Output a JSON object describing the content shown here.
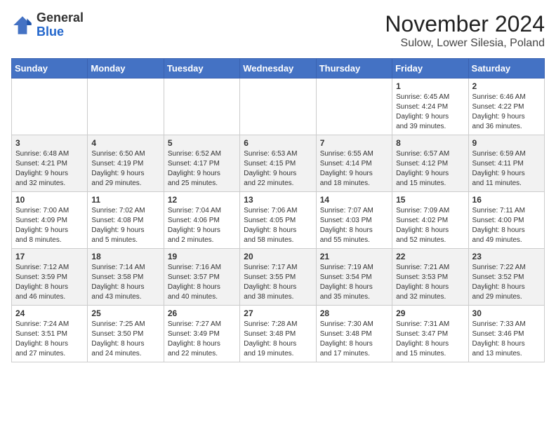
{
  "header": {
    "logo_general": "General",
    "logo_blue": "Blue",
    "month": "November 2024",
    "location": "Sulow, Lower Silesia, Poland"
  },
  "days_of_week": [
    "Sunday",
    "Monday",
    "Tuesday",
    "Wednesday",
    "Thursday",
    "Friday",
    "Saturday"
  ],
  "weeks": [
    [
      {
        "day": "",
        "info": ""
      },
      {
        "day": "",
        "info": ""
      },
      {
        "day": "",
        "info": ""
      },
      {
        "day": "",
        "info": ""
      },
      {
        "day": "",
        "info": ""
      },
      {
        "day": "1",
        "info": "Sunrise: 6:45 AM\nSunset: 4:24 PM\nDaylight: 9 hours\nand 39 minutes."
      },
      {
        "day": "2",
        "info": "Sunrise: 6:46 AM\nSunset: 4:22 PM\nDaylight: 9 hours\nand 36 minutes."
      }
    ],
    [
      {
        "day": "3",
        "info": "Sunrise: 6:48 AM\nSunset: 4:21 PM\nDaylight: 9 hours\nand 32 minutes."
      },
      {
        "day": "4",
        "info": "Sunrise: 6:50 AM\nSunset: 4:19 PM\nDaylight: 9 hours\nand 29 minutes."
      },
      {
        "day": "5",
        "info": "Sunrise: 6:52 AM\nSunset: 4:17 PM\nDaylight: 9 hours\nand 25 minutes."
      },
      {
        "day": "6",
        "info": "Sunrise: 6:53 AM\nSunset: 4:15 PM\nDaylight: 9 hours\nand 22 minutes."
      },
      {
        "day": "7",
        "info": "Sunrise: 6:55 AM\nSunset: 4:14 PM\nDaylight: 9 hours\nand 18 minutes."
      },
      {
        "day": "8",
        "info": "Sunrise: 6:57 AM\nSunset: 4:12 PM\nDaylight: 9 hours\nand 15 minutes."
      },
      {
        "day": "9",
        "info": "Sunrise: 6:59 AM\nSunset: 4:11 PM\nDaylight: 9 hours\nand 11 minutes."
      }
    ],
    [
      {
        "day": "10",
        "info": "Sunrise: 7:00 AM\nSunset: 4:09 PM\nDaylight: 9 hours\nand 8 minutes."
      },
      {
        "day": "11",
        "info": "Sunrise: 7:02 AM\nSunset: 4:08 PM\nDaylight: 9 hours\nand 5 minutes."
      },
      {
        "day": "12",
        "info": "Sunrise: 7:04 AM\nSunset: 4:06 PM\nDaylight: 9 hours\nand 2 minutes."
      },
      {
        "day": "13",
        "info": "Sunrise: 7:06 AM\nSunset: 4:05 PM\nDaylight: 8 hours\nand 58 minutes."
      },
      {
        "day": "14",
        "info": "Sunrise: 7:07 AM\nSunset: 4:03 PM\nDaylight: 8 hours\nand 55 minutes."
      },
      {
        "day": "15",
        "info": "Sunrise: 7:09 AM\nSunset: 4:02 PM\nDaylight: 8 hours\nand 52 minutes."
      },
      {
        "day": "16",
        "info": "Sunrise: 7:11 AM\nSunset: 4:00 PM\nDaylight: 8 hours\nand 49 minutes."
      }
    ],
    [
      {
        "day": "17",
        "info": "Sunrise: 7:12 AM\nSunset: 3:59 PM\nDaylight: 8 hours\nand 46 minutes."
      },
      {
        "day": "18",
        "info": "Sunrise: 7:14 AM\nSunset: 3:58 PM\nDaylight: 8 hours\nand 43 minutes."
      },
      {
        "day": "19",
        "info": "Sunrise: 7:16 AM\nSunset: 3:57 PM\nDaylight: 8 hours\nand 40 minutes."
      },
      {
        "day": "20",
        "info": "Sunrise: 7:17 AM\nSunset: 3:55 PM\nDaylight: 8 hours\nand 38 minutes."
      },
      {
        "day": "21",
        "info": "Sunrise: 7:19 AM\nSunset: 3:54 PM\nDaylight: 8 hours\nand 35 minutes."
      },
      {
        "day": "22",
        "info": "Sunrise: 7:21 AM\nSunset: 3:53 PM\nDaylight: 8 hours\nand 32 minutes."
      },
      {
        "day": "23",
        "info": "Sunrise: 7:22 AM\nSunset: 3:52 PM\nDaylight: 8 hours\nand 29 minutes."
      }
    ],
    [
      {
        "day": "24",
        "info": "Sunrise: 7:24 AM\nSunset: 3:51 PM\nDaylight: 8 hours\nand 27 minutes."
      },
      {
        "day": "25",
        "info": "Sunrise: 7:25 AM\nSunset: 3:50 PM\nDaylight: 8 hours\nand 24 minutes."
      },
      {
        "day": "26",
        "info": "Sunrise: 7:27 AM\nSunset: 3:49 PM\nDaylight: 8 hours\nand 22 minutes."
      },
      {
        "day": "27",
        "info": "Sunrise: 7:28 AM\nSunset: 3:48 PM\nDaylight: 8 hours\nand 19 minutes."
      },
      {
        "day": "28",
        "info": "Sunrise: 7:30 AM\nSunset: 3:48 PM\nDaylight: 8 hours\nand 17 minutes."
      },
      {
        "day": "29",
        "info": "Sunrise: 7:31 AM\nSunset: 3:47 PM\nDaylight: 8 hours\nand 15 minutes."
      },
      {
        "day": "30",
        "info": "Sunrise: 7:33 AM\nSunset: 3:46 PM\nDaylight: 8 hours\nand 13 minutes."
      }
    ]
  ]
}
